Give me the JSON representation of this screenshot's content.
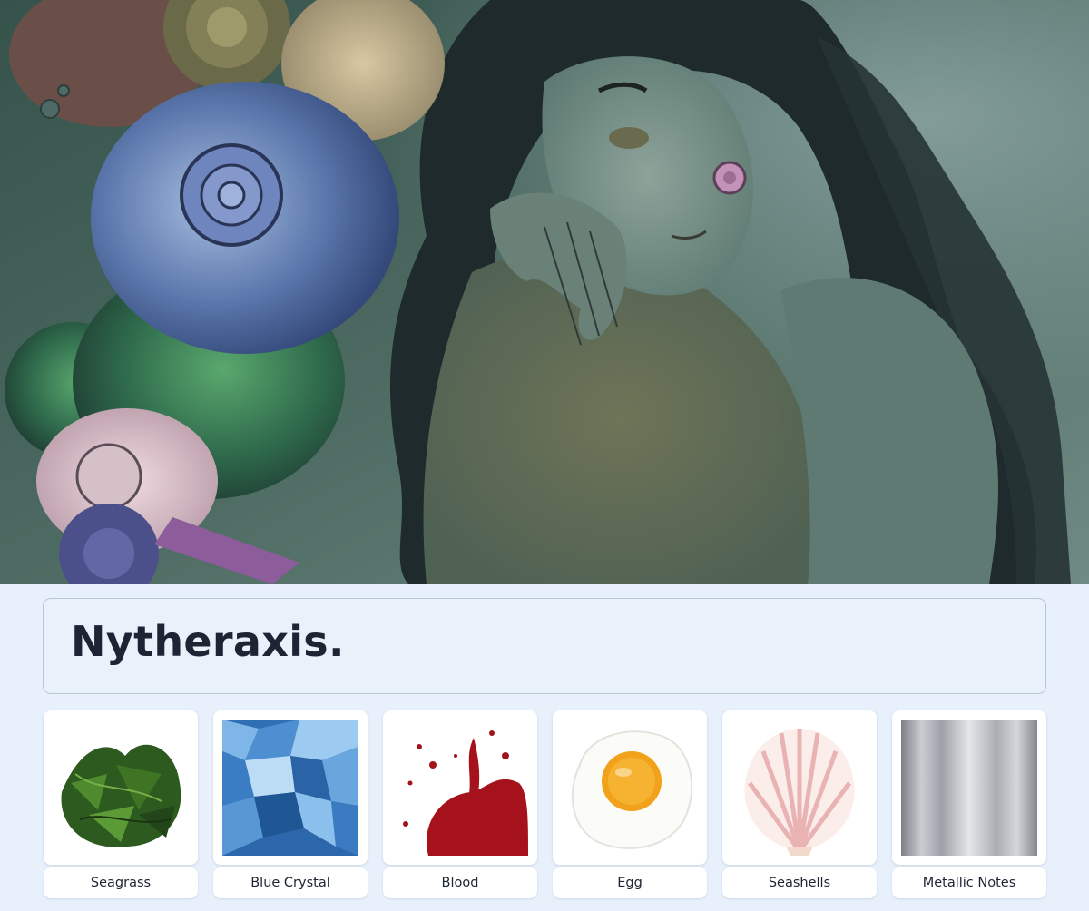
{
  "hero": {
    "image_name": "mermaid-with-seashells-illustration"
  },
  "title": "Nytheraxis.",
  "notes": [
    {
      "label": "Seagrass",
      "icon": "seagrass-image"
    },
    {
      "label": "Blue Crystal",
      "icon": "blue-crystal-image"
    },
    {
      "label": "Blood",
      "icon": "blood-splatter-image"
    },
    {
      "label": "Egg",
      "icon": "fried-egg-image"
    },
    {
      "label": "Seashells",
      "icon": "scallop-shell-image"
    },
    {
      "label": "Metallic Notes",
      "icon": "brushed-metal-image"
    }
  ],
  "colors": {
    "page_background": "#e8f1fb",
    "title_text": "#1d2433",
    "panel_border": "#b9c6d3"
  }
}
